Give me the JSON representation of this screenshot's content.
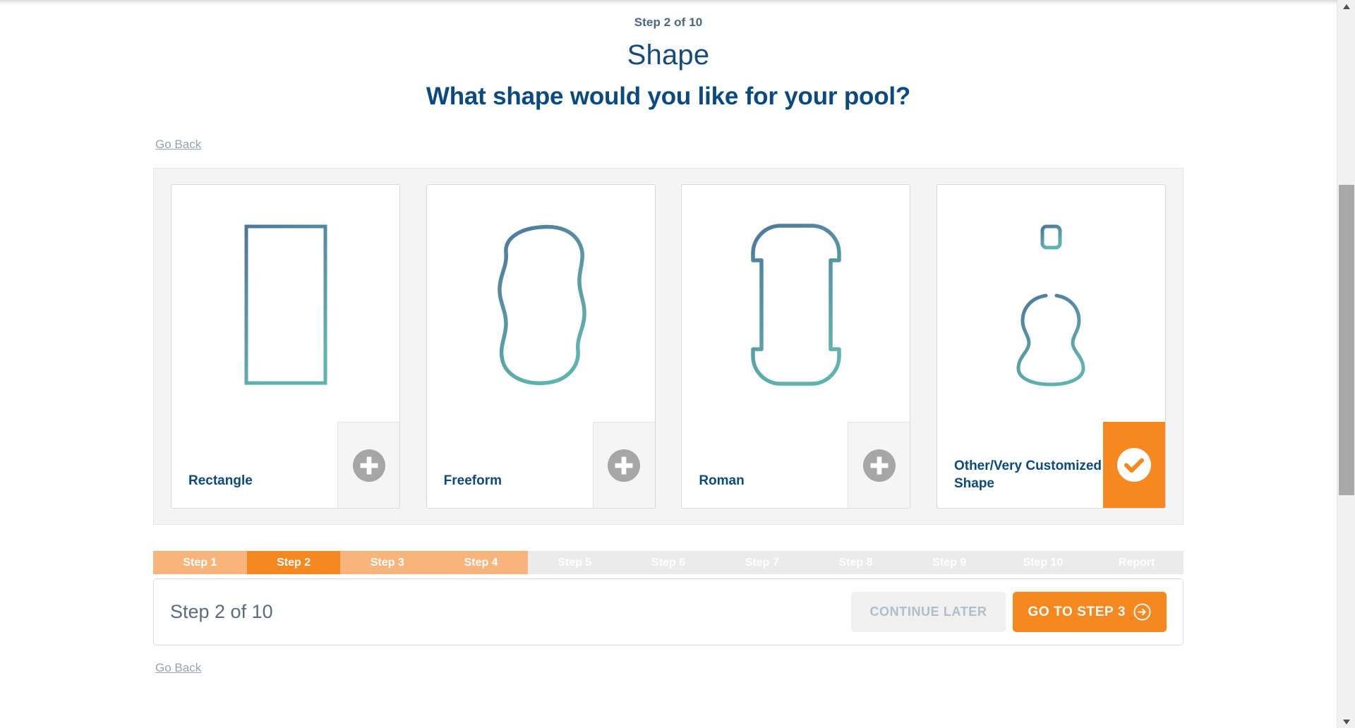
{
  "header": {
    "step_eyebrow": "Step 2 of 10",
    "section_title": "Shape",
    "question": "What shape would you like for your pool?"
  },
  "links": {
    "go_back_top": "Go Back",
    "go_back_bottom": "Go Back"
  },
  "options": [
    {
      "label": "Rectangle",
      "shape": "rectangle",
      "selected": false,
      "action_icon": "plus-icon"
    },
    {
      "label": "Freeform",
      "shape": "freeform",
      "selected": false,
      "action_icon": "plus-icon"
    },
    {
      "label": "Roman",
      "shape": "roman",
      "selected": false,
      "action_icon": "plus-icon"
    },
    {
      "label": "Other/Very Customized Shape",
      "shape": "guitar",
      "selected": true,
      "action_icon": "check-icon"
    }
  ],
  "step_bar": [
    {
      "label": "Step 1",
      "state": "done"
    },
    {
      "label": "Step 2",
      "state": "active"
    },
    {
      "label": "Step 3",
      "state": "done"
    },
    {
      "label": "Step 4",
      "state": "done"
    },
    {
      "label": "Step 5",
      "state": "todo"
    },
    {
      "label": "Step 6",
      "state": "todo"
    },
    {
      "label": "Step 7",
      "state": "todo"
    },
    {
      "label": "Step 8",
      "state": "todo"
    },
    {
      "label": "Step 9",
      "state": "todo"
    },
    {
      "label": "Step 10",
      "state": "todo"
    },
    {
      "label": "Report",
      "state": "todo"
    }
  ],
  "footer": {
    "progress_text": "Step 2 of 10",
    "continue_later_label": "CONTINUE LATER",
    "next_label": "GO TO STEP 3"
  },
  "colors": {
    "accent_orange": "#F7881F",
    "orange_done": "#F9B47C",
    "step_todo": "#EBEBEB",
    "navy": "#0B4A80",
    "section_blue": "#154A7D",
    "eyebrow_blue": "#4C6584",
    "shape_top": "#4E779C",
    "shape_bottom": "#5FB3AE",
    "panel_bg": "#F4F4F4",
    "link_gray": "#9AA2AB"
  }
}
